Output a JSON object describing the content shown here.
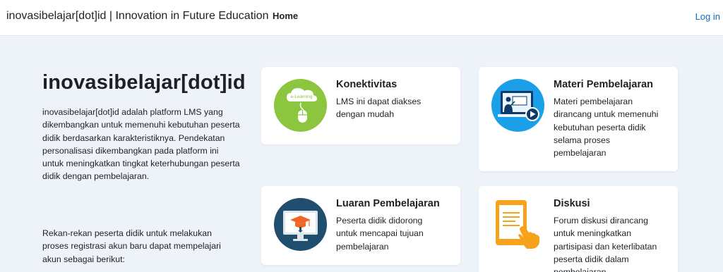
{
  "navbar": {
    "brand": "inovasibelajar[dot]id | Innovation in Future Education",
    "home": "Home",
    "login": "Log in"
  },
  "hero": {
    "title": "inovasibelajar[dot]id",
    "description": "inovasibelajar[dot]id adalah platform LMS yang dikembangkan untuk memenuhi kebutuhan peserta didik berdasarkan karakteristiknya. Pendekatan personalisasi dikembangkan pada platform ini untuk meningkatkan tingkat keterhubungan peserta didik dengan pembelajaran.",
    "registration": "Rekan-rekan peserta didik untuk melakukan proses registrasi akun baru dapat mempelajari akun sebagai berikut:"
  },
  "cards": [
    {
      "title": "Konektivitas",
      "description": "LMS ini dapat diakses dengan mudah",
      "icon": "elearning-cloud-mouse-icon",
      "icon_badge": "e-Learning"
    },
    {
      "title": "Materi Pembelajaran",
      "description": "Materi pembelajaran dirancang untuk memenuhi kebutuhan peserta didik selama proses pembelajaran",
      "icon": "teacher-screen-play-icon"
    },
    {
      "title": "Luaran Pembelajaran",
      "description": "Peserta didik didorong untuk mencapai tujuan pembelajaran",
      "icon": "graduation-cap-monitor-icon"
    },
    {
      "title": "Diskusi",
      "description": "Forum diskusi dirancang untuk meningkatkan partisipasi dan keterlibatan peserta didik dalam pembelajaran",
      "icon": "tablet-hand-touch-icon"
    }
  ],
  "colors": {
    "background": "#eef3fa",
    "link": "#0f6cbf",
    "card_green": "#8cc63f",
    "card_blue": "#1b9fe8",
    "card_navy": "#1f4e6e",
    "card_orange": "#f7a21b"
  }
}
